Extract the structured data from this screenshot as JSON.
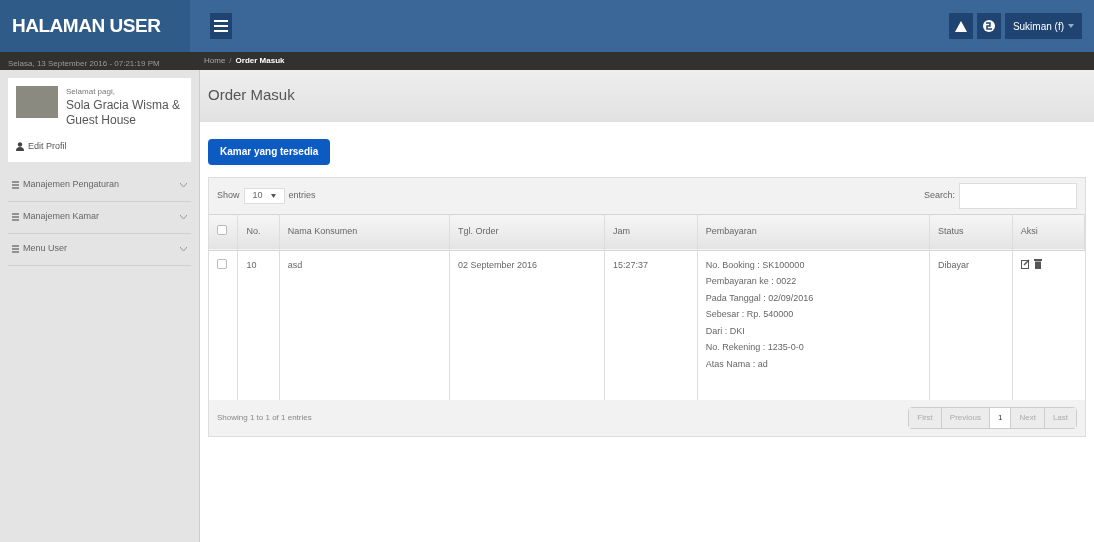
{
  "brand": "HALAMAN USER",
  "topbar": {
    "user_menu": "Sukiman (f)"
  },
  "datetime": "Selasa, 13 September 2016 - 07:21:19 PM",
  "breadcrumb": [
    "Home",
    "Order Masuk"
  ],
  "breadcrumb_separator": "/",
  "profile": {
    "greeting": "Selamat pagi,",
    "name": "Sola Gracia Wisma & Guest House",
    "edit_link": "Edit Profil"
  },
  "sidebar": {
    "items": [
      {
        "label": "Manajemen Pengaturan",
        "expanded": false
      },
      {
        "label": "Manajemen Kamar",
        "expanded": false
      },
      {
        "label": "Menu User",
        "expanded": false
      }
    ]
  },
  "page_title": "Order Masuk",
  "primary_button": "Kamar yang tersedia",
  "table": {
    "length_prefix": "Show",
    "length_value": "10",
    "length_suffix": "entries",
    "search_label": "Search:",
    "select_all_checked": false,
    "columns": [
      "No.",
      "Nama Konsumen",
      "Tgl. Order",
      "Jam",
      "Pembayaran",
      "Status",
      "Aksi"
    ],
    "rows": [
      {
        "checked": false,
        "no": "10",
        "name": "asd",
        "date": "02 September 2016",
        "time": "15:27:37",
        "payment": [
          "No. Booking : SK100000",
          "Pembayaran ke : 0022",
          "Pada Tanggal : 02/09/2016",
          "Sebesar : Rp. 540000",
          "Dari : DKI",
          "No. Rekening : 1235-0-0",
          "Atas Nama : ad"
        ],
        "status": "Dibayar"
      }
    ],
    "info": "Showing 1 to 1 of 1 entries",
    "pagination": [
      {
        "label": "First",
        "selected": false
      },
      {
        "label": "Previous",
        "selected": false
      },
      {
        "label": "1",
        "selected": true
      },
      {
        "label": "Next",
        "selected": false
      },
      {
        "label": "Last",
        "selected": false
      }
    ]
  }
}
